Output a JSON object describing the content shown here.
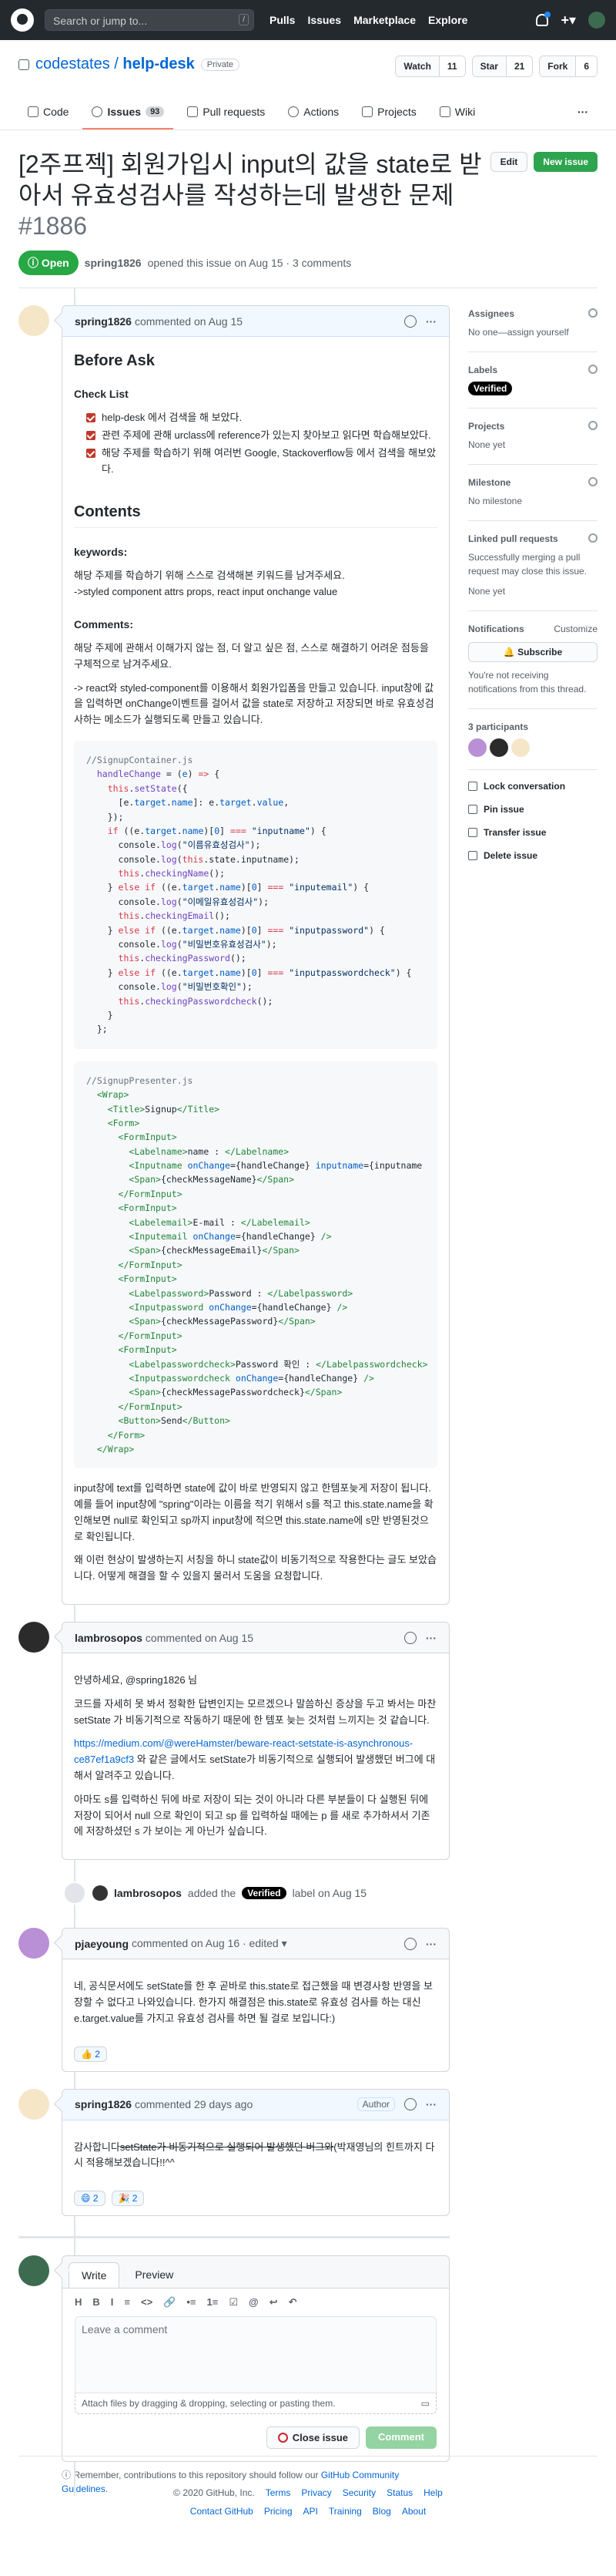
{
  "header": {
    "search": "Search or jump to...",
    "slash": "/",
    "nav": [
      "Pulls",
      "Issues",
      "Marketplace",
      "Explore"
    ]
  },
  "repo": {
    "owner": "codestates",
    "name": "help-desk",
    "visibility": "Private",
    "watch": "Watch",
    "watch_count": "11",
    "star": "Star",
    "star_count": "21",
    "fork": "Fork",
    "fork_count": "6"
  },
  "tabs": [
    {
      "label": "Code"
    },
    {
      "label": "Issues",
      "count": "93"
    },
    {
      "label": "Pull requests"
    },
    {
      "label": "Actions"
    },
    {
      "label": "Projects"
    },
    {
      "label": "Wiki"
    }
  ],
  "issue": {
    "title": "[2주프젝] 회원가입시 input의 값을 state로 받아서 유효성검사를 작성하는데 발생한 문제",
    "number": "#1886",
    "edit": "Edit",
    "new_issue": "New issue",
    "state": "Open",
    "author": "spring1826",
    "meta": "opened this issue on Aug 15 · 3 comments"
  },
  "c1": {
    "author": "spring1826",
    "when": "commented on Aug 15",
    "h_before": "Before Ask",
    "h_check": "Check List",
    "checks": [
      "help-desk 에서 검색을 해 보았다.",
      "관련 주제에 관해 urclass에 reference가 있는지 찾아보고 읽다면 학습해보았다.",
      "해당 주제를 학습하기 위해 여러번 Google, Stackoverflow등 에서 검색을 해보았다."
    ],
    "h_contents": "Contents",
    "h_keywords": "keywords:",
    "kw1": "해당 주제를 학습하기 위해 스스로 검색해본 키워드를 남겨주세요.",
    "kw2": "->styled component attrs props, react input onchange value",
    "h_comments": "Comments:",
    "cm1": "해당 주제에 관해서 이해가지 않는 점, 더 알고 싶은 점, 스스로 해결하기 어려운 점등을 구체적으로 남겨주세요.",
    "cm2": "-> react와 styled-component를 이용해서 회원가입폼을 만들고 있습니다. input창에 값을 입력하면 onChange이벤트를 걸어서 값을 state로 저장하고 저장되면 바로 유효성검사하는 메소드가 실행되도록 만들고 있습니다.",
    "after1": "input창에 text를 입력하면 state에 값이 바로 반영되지 않고 한템포늦게 저장이 됩니다. 예를 들어 input창에 \"spring\"이라는 이름을 적기 위해서 s를 적고 this.state.name을 확인해보면 null로 확인되고 sp까지 input창에 적으면 this.state.name에 s만 반영된것으로 확인됩니다.",
    "after2": "왜 이런 현상이 발생하는지 서칭을 하니 state값이 비동기적으로 작용한다는 글도 보았습니다. 어떻게 해결을 할 수 있을지 물러서 도움을 요청합니다."
  },
  "c2": {
    "author": "lambrosopos",
    "when": "commented on Aug 15",
    "p1": "안녕하세요, @spring1826 님",
    "p2": "코드를 자세히 못 봐서 정확한 답변인지는 모르겠으나 말씀하신 증상을 두고 봐서는 마찬 setState 가 비동기적으로 작동하기 때문에 한 템포 늦는 것처럼 느끼지는 것 같습니다.",
    "link": "https://medium.com/@wereHamster/beware-react-setstate-is-asynchronous-ce87ef1a9cf3",
    "p3": "와 같은 글에서도 setState가 비동기적으로 실행되어 발생했던 버그에 대해서 알려주고 있습니다.",
    "p4": "아마도 s를 입력하신 뒤에 바로 저장이 되는 것이 아니라 다른 부분들이 다 실행된 뒤에 저장이 되어서 null 으로 확인이 되고 sp 를 입력하실 때에는 p 를 새로 추가하셔서 기존에 저장하셨던 s 가 보이는 게 아닌가 싶습니다."
  },
  "event": {
    "actor": "lambrosopos",
    "text1": "added the",
    "label": "Verified",
    "text2": "label on Aug 15"
  },
  "c3": {
    "author": "pjaeyoung",
    "when": "commented on Aug 16 · edited ▾",
    "p1": "네, 공식문서에도 setState를 한 후 곧바로 this.state로 접근했을 때 변경사항 반영을 보장할 수 없다고 나와있습니다. 한가지 해결점은 this.state로 유효성 검사를 하는 대신 e.target.value를 가지고 유효성 검사를 하면 될 걸로 보입니다:)",
    "reaction": "👍 2"
  },
  "c4": {
    "author": "spring1826",
    "when": "commented 29 days ago",
    "badge": "Author",
    "pre": "감사합니다",
    "strike": "setState가 비동기적으로 실행되어 발생했던 버그와",
    "post": "(박재영님의 힌트까지 다시 적용해보겠습니다!!^^",
    "r1": "😄 2",
    "r2": "🎉 2"
  },
  "write": {
    "write": "Write",
    "preview": "Preview",
    "tools": [
      "H",
      "B",
      "I",
      "≡",
      "<>",
      "🔗",
      "•≡",
      "1≡",
      "☑",
      "@",
      "↩",
      "↶"
    ],
    "placeholder": "Leave a comment",
    "attach": "Attach files by dragging & dropping, selecting or pasting them.",
    "close": "Close issue",
    "comment": "Comment",
    "tip_pre": "Remember, contributions to this repository should follow our",
    "tip_link": "GitHub Community Guidelines",
    "tip_post": "."
  },
  "sidebar": {
    "assignees": "Assignees",
    "assignees_v": "No one—assign yourself",
    "labels": "Labels",
    "label_v": "Verified",
    "projects": "Projects",
    "projects_v": "None yet",
    "milestone": "Milestone",
    "milestone_v": "No milestone",
    "linked": "Linked pull requests",
    "linked_v": "Successfully merging a pull request may close this issue.",
    "linked_v2": "None yet",
    "notif": "Notifications",
    "customize": "Customize",
    "subscribe": "Subscribe",
    "notif_v": "You're not receiving notifications from this thread.",
    "parts": "3 participants",
    "lock": "Lock conversation",
    "pin": "Pin issue",
    "transfer": "Transfer issue",
    "delete": "Delete issue"
  },
  "footer": {
    "copy": "© 2020 GitHub, Inc.",
    "row1": [
      "Terms",
      "Privacy",
      "Security",
      "Status",
      "Help"
    ],
    "row2": [
      "Contact GitHub",
      "Pricing",
      "API",
      "Training",
      "Blog",
      "About"
    ]
  }
}
